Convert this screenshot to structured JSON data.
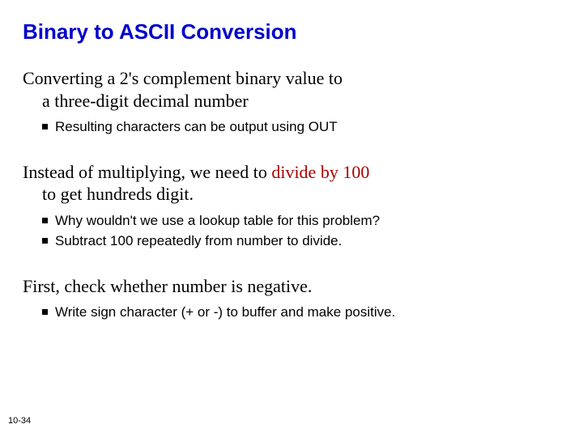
{
  "title": "Binary to ASCII Conversion",
  "sections": [
    {
      "line1": "Converting a 2's complement binary value to",
      "line2": "a three-digit decimal number",
      "bullets": [
        "Resulting characters can be output using OUT"
      ]
    },
    {
      "line1_a": "Instead of multiplying, we need to ",
      "line1_hl": "divide by 100",
      "line2": "to get hundreds digit.",
      "bullets": [
        "Why wouldn't we use a lookup table for this problem?",
        "Subtract 100 repeatedly from number to divide."
      ]
    },
    {
      "line1": "First, check whether number is negative.",
      "bullets": [
        "Write sign character (+ or -) to buffer and make positive."
      ]
    }
  ],
  "footer": "10-34"
}
